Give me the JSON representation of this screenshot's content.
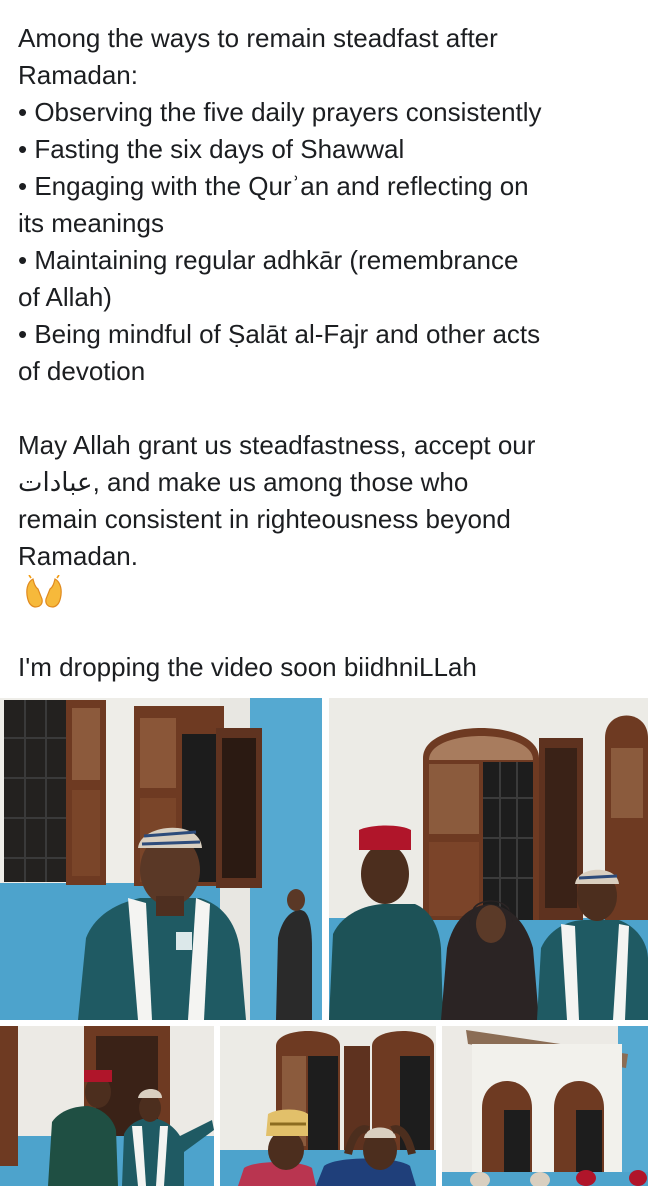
{
  "post": {
    "lines": [
      "Among the ways to remain steadfast after",
      "Ramadan:",
      "• Observing the five daily prayers consistently",
      "• Fasting the six days of Shawwal",
      "• Engaging with the Qurʾan and reflecting on",
      "its meanings",
      "• Maintaining regular adhkār (remembrance",
      "of Allah)",
      "• Being mindful of Ṣalāt al-Fajr and other acts",
      "of devotion",
      "",
      "May Allah grant us steadfastness, accept our",
      "عبادات, and make us among those who",
      "remain consistent in righteousness beyond",
      "Ramadan."
    ],
    "emoji_icon": "raising-hands-icon",
    "closing_line": "I'm dropping the video soon biidhniLLah"
  },
  "photos": [
    {
      "name": "photo-1",
      "description_icon": "photo-icon"
    },
    {
      "name": "photo-2",
      "description_icon": "photo-icon"
    },
    {
      "name": "photo-3",
      "description_icon": "photo-icon"
    },
    {
      "name": "photo-4",
      "description_icon": "photo-icon"
    },
    {
      "name": "photo-5",
      "description_icon": "photo-icon"
    }
  ],
  "colors": {
    "text": "#1c1e21",
    "wall_white": "#f1f0ec",
    "wall_blue": "#4fa6cf",
    "window_brown": "#6e3a22",
    "robe_teal": "#1f5a63"
  }
}
